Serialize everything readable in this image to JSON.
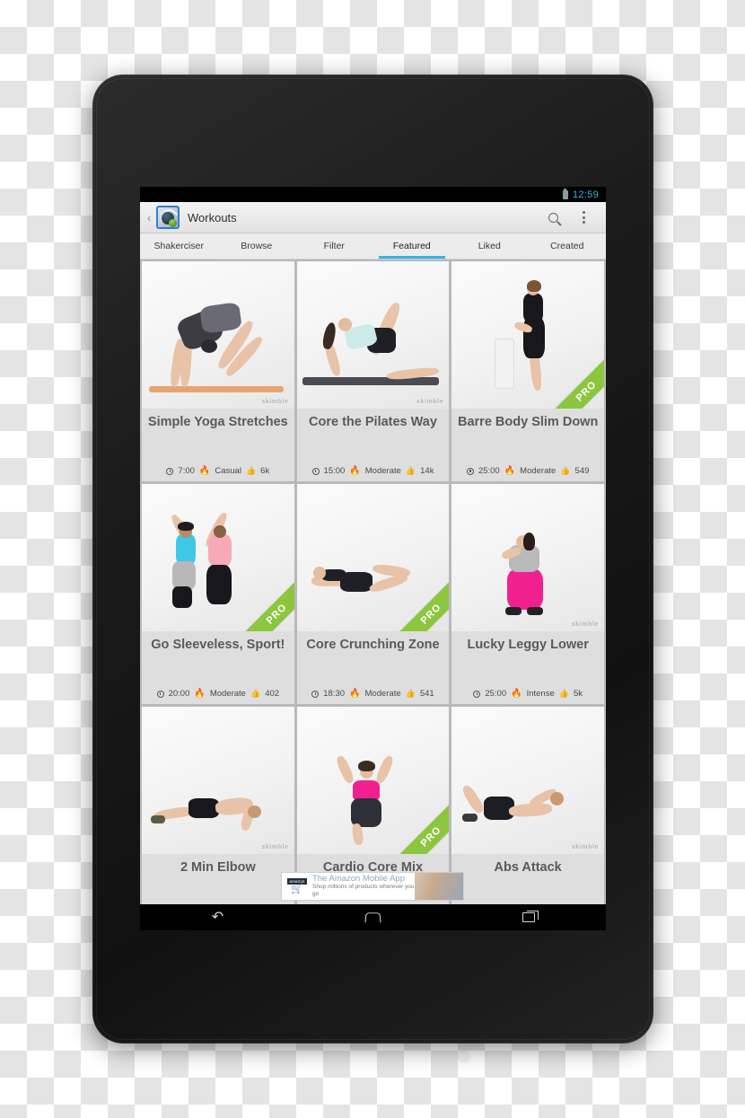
{
  "device": {
    "type": "android-tablet",
    "orientation": "portrait"
  },
  "statusbar": {
    "time": "12:59",
    "battery_icon": "battery-icon",
    "accent_color": "#33b5e5"
  },
  "actionbar": {
    "up_caret": "‹",
    "app_icon": "workouts-app-icon",
    "title": "Workouts",
    "search_icon": "search-icon",
    "overflow_icon": "overflow-menu-icon"
  },
  "tabs": [
    {
      "label": "Shakerciser",
      "active": false
    },
    {
      "label": "Browse",
      "active": false
    },
    {
      "label": "Filter",
      "active": false
    },
    {
      "label": "Featured",
      "active": true
    },
    {
      "label": "Liked",
      "active": false
    },
    {
      "label": "Created",
      "active": false
    }
  ],
  "watermark": "skimble",
  "pro_badge_label": "PRO",
  "workouts": [
    {
      "title": "Simple Yoga Stretches",
      "duration": "7:00",
      "intensity": "Casual",
      "intensity_color": "#8cc63f",
      "likes": "6k",
      "pro": false,
      "watermark": true,
      "pose": "downward-dog"
    },
    {
      "title": "Core the Pilates Way",
      "duration": "15:00",
      "intensity": "Moderate",
      "intensity_color": "#f1c40f",
      "likes": "14k",
      "pro": false,
      "watermark": true,
      "pose": "side-plank-leg-raise"
    },
    {
      "title": "Barre Body Slim Down",
      "duration": "25:00",
      "intensity": "Moderate",
      "intensity_color": "#f1c40f",
      "likes": "549",
      "pro": true,
      "watermark": false,
      "pose": "chair-barre"
    },
    {
      "title": "Go Sleeveless, Sport!",
      "duration": "20:00",
      "intensity": "Moderate",
      "intensity_color": "#f1c40f",
      "likes": "402",
      "pro": true,
      "watermark": false,
      "pose": "partner-dance"
    },
    {
      "title": "Core Crunching Zone",
      "duration": "18:30",
      "intensity": "Moderate",
      "intensity_color": "#f1c40f",
      "likes": "541",
      "pro": true,
      "watermark": false,
      "pose": "bicycle-crunch"
    },
    {
      "title": "Lucky Leggy Lower",
      "duration": "25:00",
      "intensity": "Intense",
      "intensity_color": "#e8604c",
      "likes": "5k",
      "pro": false,
      "watermark": true,
      "pose": "squat"
    },
    {
      "title": "2 Min Elbow",
      "duration": "",
      "intensity": "",
      "intensity_color": "#f1c40f",
      "likes": "",
      "pro": false,
      "watermark": true,
      "pose": "elbow-plank"
    },
    {
      "title": "Cardio Core Mix",
      "duration": "",
      "intensity": "",
      "intensity_color": "#f1c40f",
      "likes": "",
      "pro": true,
      "watermark": false,
      "pose": "high-knee"
    },
    {
      "title": "Abs Attack",
      "duration": "",
      "intensity": "",
      "intensity_color": "#f1c40f",
      "likes": "",
      "pro": false,
      "watermark": true,
      "pose": "side-crunch"
    }
  ],
  "ad": {
    "brand": "amazon",
    "headline": "The Amazon Mobile App",
    "subline": "Shop millions of products wherever you go",
    "cart_icon": "shopping-cart-icon"
  },
  "navbar": {
    "back_icon": "back-icon",
    "home_icon": "home-icon",
    "recents_icon": "recent-apps-icon"
  }
}
